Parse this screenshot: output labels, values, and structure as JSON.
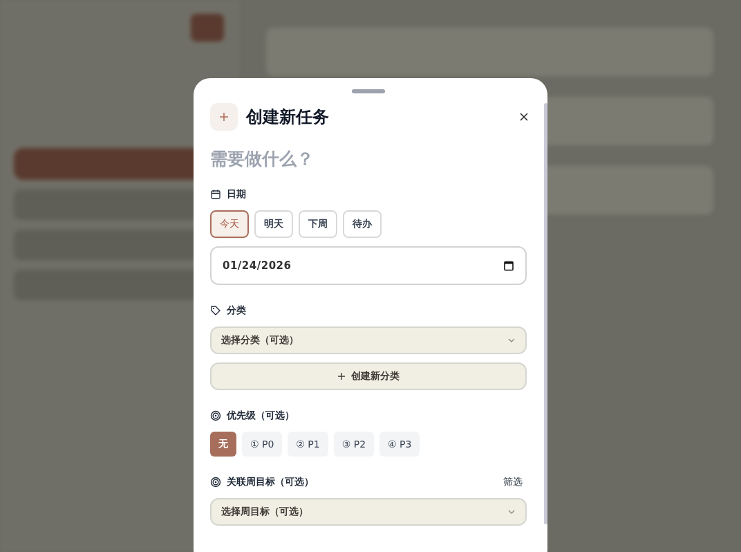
{
  "modal": {
    "title": "创建新任务",
    "task_input": {
      "placeholder": "需要做什么？"
    },
    "date_section": {
      "label": "日期",
      "options": [
        {
          "label": "今天",
          "selected": true
        },
        {
          "label": "明天",
          "selected": false
        },
        {
          "label": "下周",
          "selected": false
        },
        {
          "label": "待办",
          "selected": false
        }
      ],
      "date_value": "01/24/2026"
    },
    "category_section": {
      "label": "分类",
      "select_placeholder": "选择分类（可选）",
      "create_button": "创建新分类"
    },
    "priority_section": {
      "label": "优先级（可选）",
      "options": [
        {
          "label": "无",
          "selected": true
        },
        {
          "label": "① P0",
          "selected": false
        },
        {
          "label": "② P1",
          "selected": false
        },
        {
          "label": "③ P2",
          "selected": false
        },
        {
          "label": "④ P3",
          "selected": false
        }
      ]
    },
    "goal_section": {
      "label": "关联周目标（可选）",
      "filter": "筛选",
      "select_placeholder": "选择周目标（可选）"
    }
  }
}
